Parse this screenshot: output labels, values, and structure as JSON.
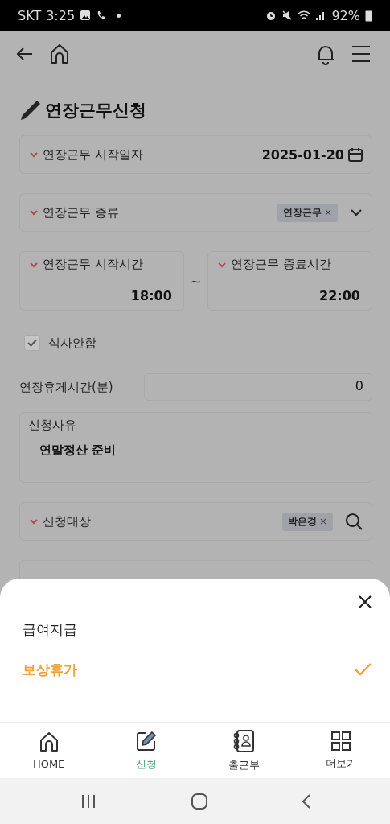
{
  "status_bar": {
    "carrier": "SKT",
    "time": "3:25",
    "battery": "92%"
  },
  "title": "연장근무신청",
  "start_date": {
    "label": "연장근무 시작일자",
    "value": "2025-01-20",
    "required": true
  },
  "work_type": {
    "label": "연장근무 종류",
    "tag": "연장근무",
    "remove": "×",
    "required": true
  },
  "times": [
    {
      "label": "연장근무 시작시간",
      "value": "18:00",
      "required": true
    },
    {
      "label": "연장근무 종료시간",
      "value": "22:00",
      "required": true
    }
  ],
  "time_separator": "~",
  "meal": {
    "label": "식사안함",
    "checked": true,
    "disabled": true
  },
  "break_time": {
    "label": "연장휴게시간(분)",
    "value": "0"
  },
  "reason": {
    "label": "신청사유",
    "value": "연말정산 준비"
  },
  "target": {
    "label": "신청대상",
    "tag": "박은경",
    "remove": "×",
    "required": true
  },
  "sheet": {
    "options": [
      {
        "label": "급여지급",
        "selected": false
      },
      {
        "label": "보상휴가",
        "selected": true
      }
    ]
  },
  "bottom_nav": [
    {
      "label": "HOME",
      "kind": "home",
      "selected": false
    },
    {
      "label": "신청",
      "kind": "edit",
      "selected": true
    },
    {
      "label": "출근부",
      "kind": "book",
      "selected": false
    },
    {
      "label": "더보기",
      "kind": "grid",
      "selected": false
    }
  ]
}
